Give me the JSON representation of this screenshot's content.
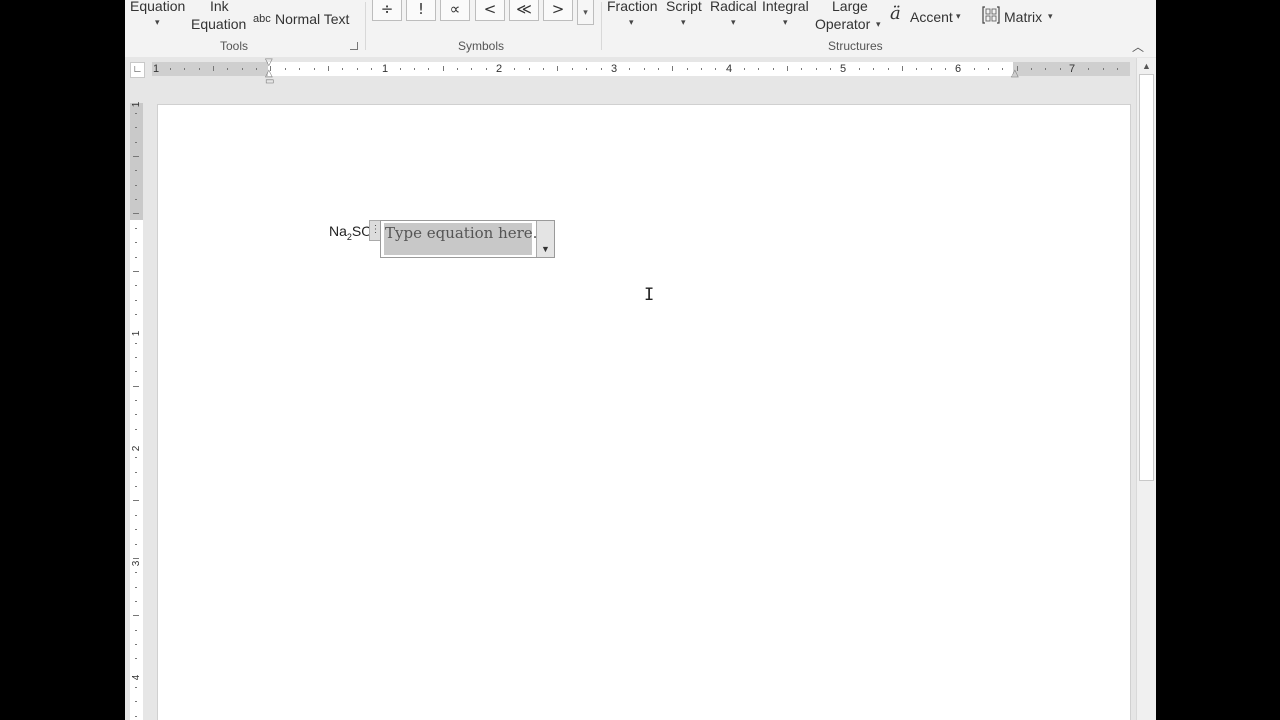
{
  "ribbon": {
    "tools": {
      "equation_label": "Equation",
      "ink_label_line1": "Ink",
      "ink_label_line2": "Equation",
      "normal_text_prefix": "abc",
      "normal_text_label": "Normal Text",
      "group_label": "Tools"
    },
    "symbols": {
      "items": [
        "÷",
        "!",
        "∝",
        "<",
        "≪",
        ">"
      ],
      "group_label": "Symbols"
    },
    "structures": {
      "fraction": "Fraction",
      "script": "Script",
      "radical": "Radical",
      "integral": "Integral",
      "large_operator_line1": "Large",
      "large_operator_line2": "Operator",
      "accent_icon": "ä",
      "accent": "Accent",
      "matrix": "Matrix",
      "group_label": "Structures"
    }
  },
  "ruler": {
    "horizontal_numbers": [
      "1",
      "1",
      "2",
      "3",
      "4",
      "5",
      "6",
      "7"
    ],
    "vertical_numbers": [
      "1",
      "1",
      "2",
      "3",
      "4"
    ]
  },
  "document": {
    "text_before": "Na",
    "subscript": "2",
    "text_after": "SO",
    "equation_placeholder": "Type equation here."
  },
  "icons": {
    "tab_selector": "tab-stop-icon",
    "matrix": "matrix-icon",
    "dropdown": "chevron-down-icon",
    "scroll_up": "scroll-up-icon",
    "cursor": "text-cursor-icon"
  }
}
